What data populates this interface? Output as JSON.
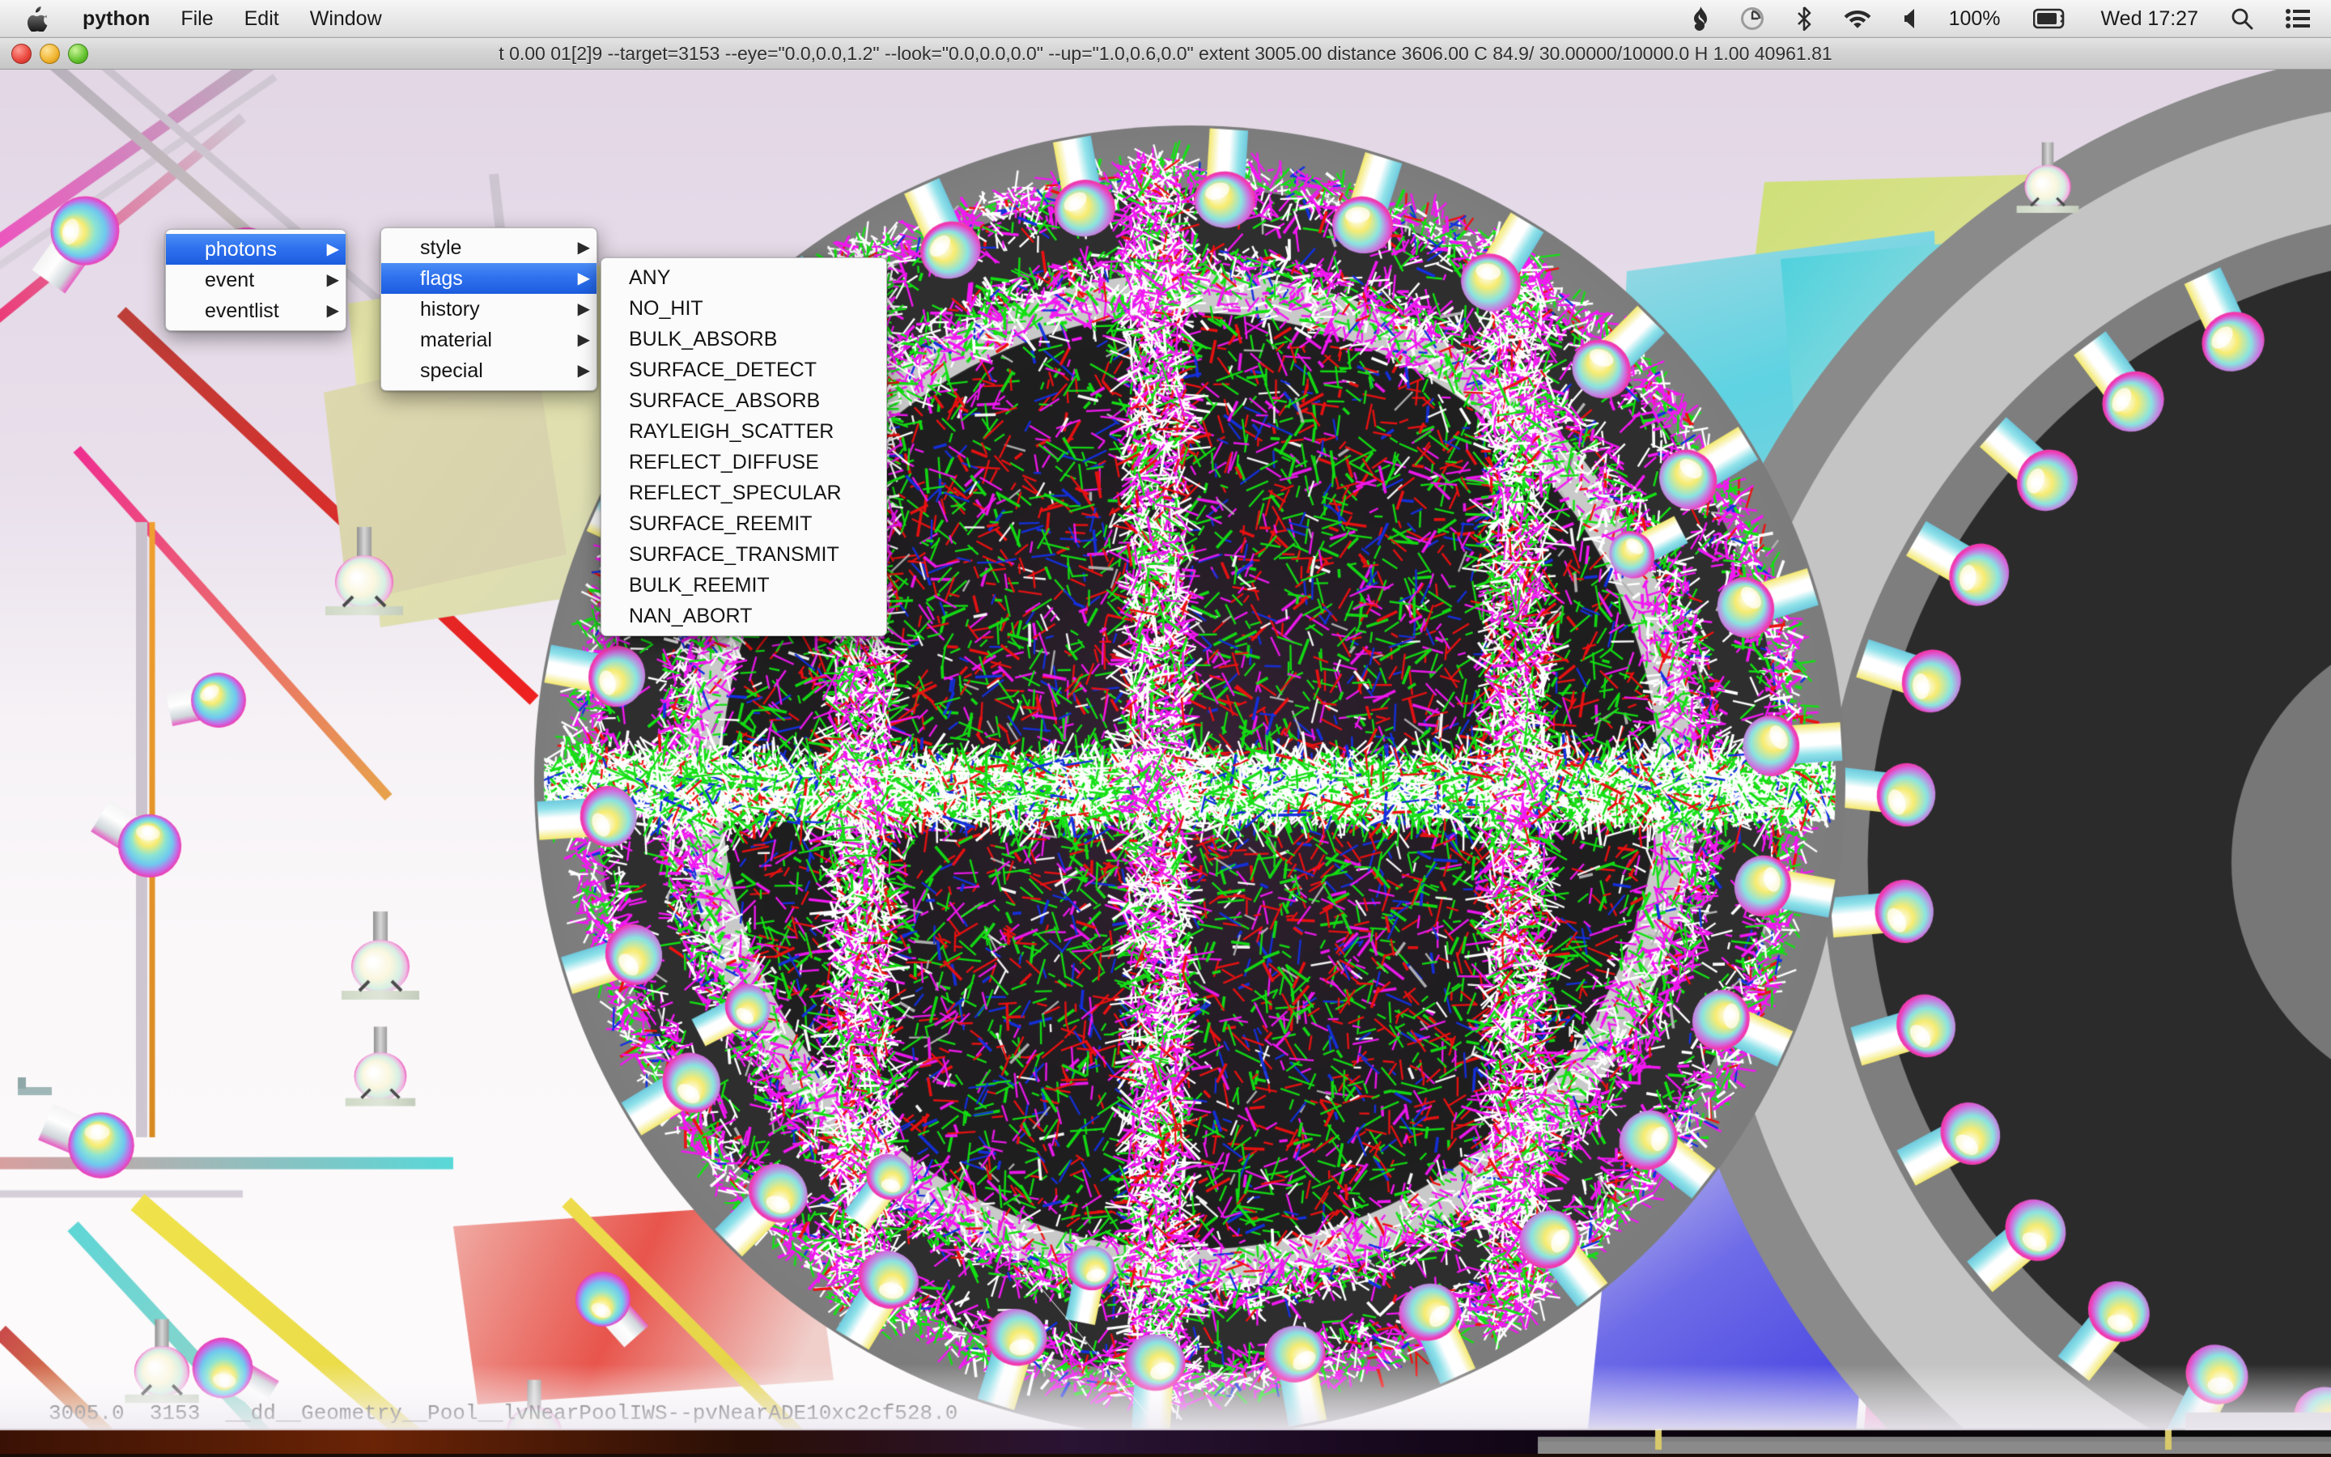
{
  "menubar": {
    "apple_icon": "apple-logo",
    "items": [
      {
        "label": "python",
        "bold": true
      },
      {
        "label": "File",
        "bold": false
      },
      {
        "label": "Edit",
        "bold": false
      },
      {
        "label": "Window",
        "bold": false
      }
    ],
    "status_icons": [
      "flame-icon",
      "time-machine-icon",
      "bluetooth-icon",
      "wifi-icon",
      "volume-icon"
    ],
    "battery_percent": "100%",
    "battery_icon": "battery-icon",
    "clock": "Wed 17:27",
    "search_icon": "search-icon",
    "notification_icon": "list-icon"
  },
  "window": {
    "traffic_lights": [
      "close-button",
      "minimize-button",
      "zoom-button"
    ],
    "title": "t  0.00 01[2]9 --target=3153 --eye=\"0.0,0.0,1.2\" --look=\"0.0,0.0,0.0\" --up=\"1.0,0.6,0.0\" extent 3005.00 distance 3606.00 C 84.9/  30.00000/10000.0  H  1.00 40961.81"
  },
  "context_menu": {
    "level1": {
      "items": [
        {
          "label": "photons",
          "selected": true,
          "has_submenu": true
        },
        {
          "label": "event",
          "selected": false,
          "has_submenu": true
        },
        {
          "label": "eventlist",
          "selected": false,
          "has_submenu": true
        }
      ]
    },
    "level2": {
      "items": [
        {
          "label": "style",
          "selected": false,
          "has_submenu": true
        },
        {
          "label": "flags",
          "selected": true,
          "has_submenu": true
        },
        {
          "label": "history",
          "selected": false,
          "has_submenu": true
        },
        {
          "label": "material",
          "selected": false,
          "has_submenu": true
        },
        {
          "label": "special",
          "selected": false,
          "has_submenu": true
        }
      ]
    },
    "level3": {
      "items": [
        {
          "label": "ANY",
          "selected": false,
          "has_submenu": false
        },
        {
          "label": "NO_HIT",
          "selected": false,
          "has_submenu": false
        },
        {
          "label": "BULK_ABSORB",
          "selected": false,
          "has_submenu": false
        },
        {
          "label": "SURFACE_DETECT",
          "selected": false,
          "has_submenu": false
        },
        {
          "label": "SURFACE_ABSORB",
          "selected": false,
          "has_submenu": false
        },
        {
          "label": "RAYLEIGH_SCATTER",
          "selected": false,
          "has_submenu": false
        },
        {
          "label": "REFLECT_DIFFUSE",
          "selected": false,
          "has_submenu": false
        },
        {
          "label": "REFLECT_SPECULAR",
          "selected": false,
          "has_submenu": false
        },
        {
          "label": "SURFACE_REEMIT",
          "selected": false,
          "has_submenu": false
        },
        {
          "label": "SURFACE_TRANSMIT",
          "selected": false,
          "has_submenu": false
        },
        {
          "label": "BULK_REEMIT",
          "selected": false,
          "has_submenu": false
        },
        {
          "label": "NAN_ABORT",
          "selected": false,
          "has_submenu": false
        }
      ]
    },
    "submenu_arrow": "chevron-right-icon"
  },
  "statusline": {
    "text": "3005.0  3153  __dd__Geometry__Pool__lvNearPoolIWS--pvNearADE10xc2cf528.0"
  },
  "scene": {
    "background_color": "#e6dbe8",
    "floor_color": "#f7f3f7",
    "shell_outer_color": "#8c8c8c",
    "shell_inner_color": "#b9b9b9",
    "cavity_color": "#262626",
    "photon_colors": [
      "#ffffff",
      "#13e013",
      "#f218f2",
      "#ee1111",
      "#1430e0",
      "#b3b3b3"
    ],
    "plane_colors": [
      "#6fd8e0",
      "#e3e39a",
      "#3a39e8",
      "#e86fc0",
      "#d9dcb0"
    ],
    "pmt_glass_colors": [
      "#f6e96a",
      "#7fe6e0",
      "#f05fd0",
      "#ffffff"
    ],
    "desktop_strip_color": "#2a1209"
  }
}
